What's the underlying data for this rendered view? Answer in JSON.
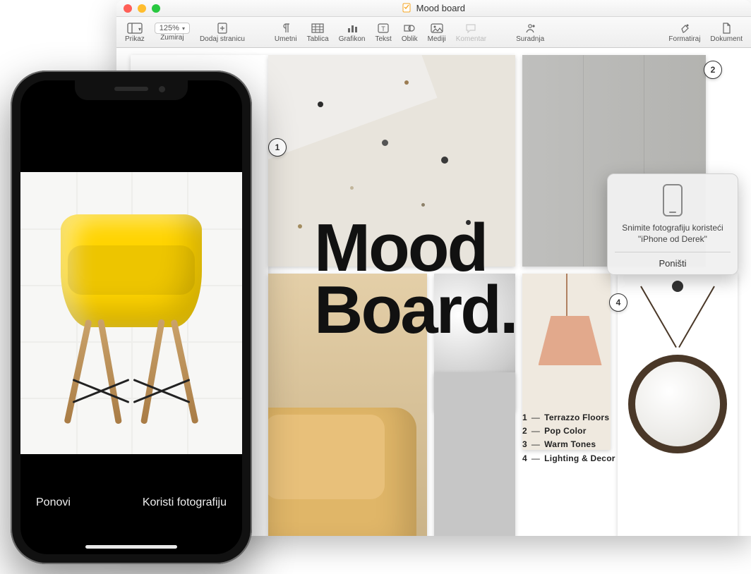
{
  "window": {
    "title": "Mood board"
  },
  "toolbar": {
    "prikaz": "Prikaz",
    "zoom_value": "125%",
    "zumiraj": "Zumiraj",
    "dodaj_stranicu": "Dodaj stranicu",
    "umetni": "Umetni",
    "tablica": "Tablica",
    "grafikon": "Grafikon",
    "tekst": "Tekst",
    "oblik": "Oblik",
    "mediji": "Mediji",
    "komentar": "Komentar",
    "suradnja": "Suradnja",
    "formatiraj": "Formatiraj",
    "dokument": "Dokument"
  },
  "document": {
    "title_line1": "Mood",
    "title_line2": "Board.",
    "callouts": {
      "c1": "1",
      "c2": "2",
      "c4": "4"
    },
    "legend": [
      {
        "num": "1",
        "text": "Terrazzo Floors"
      },
      {
        "num": "2",
        "text": "Pop Color"
      },
      {
        "num": "3",
        "text": "Warm Tones"
      },
      {
        "num": "4",
        "text": "Lighting & Decor"
      }
    ]
  },
  "popover": {
    "message": "Snimite fotografiju koristeći \"iPhone od Derek\"",
    "cancel": "Poništi"
  },
  "phone": {
    "retake": "Ponovi",
    "use": "Koristi fotografiju"
  }
}
